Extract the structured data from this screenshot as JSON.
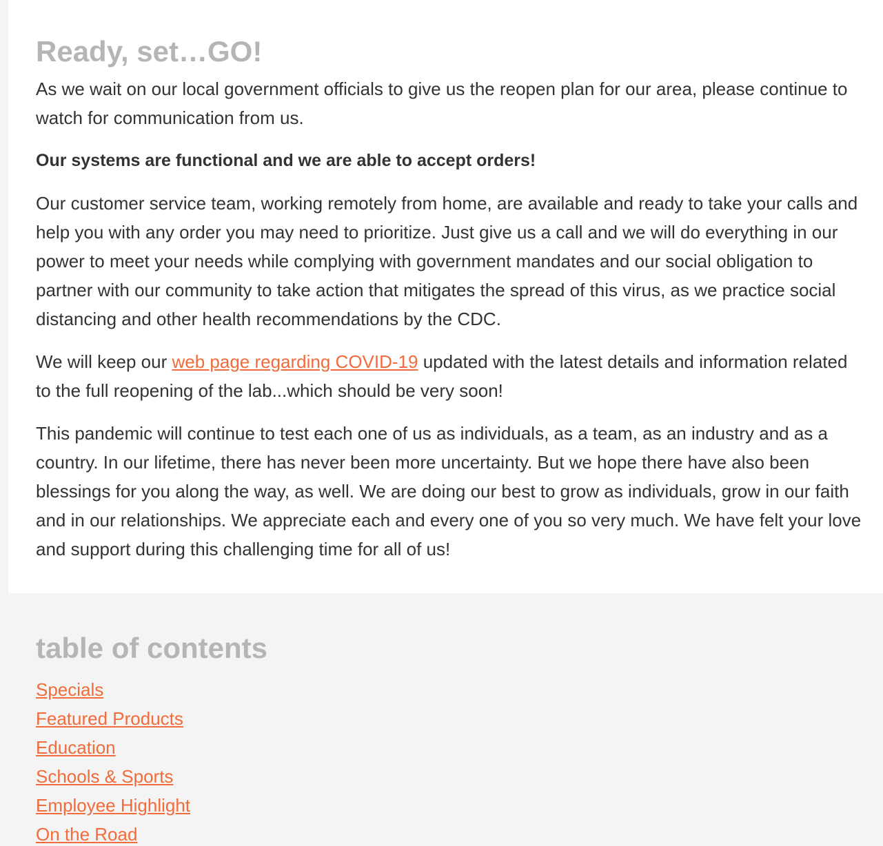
{
  "article": {
    "title": "Ready, set…GO!",
    "p1": "As we wait on our local government officials to give us the reopen plan for our area, please continue to watch for communication from us.",
    "p2": "Our systems are functional and we are able to accept orders!",
    "p3": "Our customer service team, working remotely from home, are available and ready to take your calls and help you with any order you may need to prioritize. Just give us a call and we will do everything in our power to meet your needs while complying with government mandates and our social obligation to partner with our community to take action that mitigates the spread of this virus, as we practice social distancing and other health recommendations by the CDC.",
    "p4_before": "We will keep our ",
    "p4_link": "web page regarding COVID-19",
    "p4_after": " updated with the latest details and information related to the full reopening of the lab...which should be very soon!",
    "p5": "This pandemic will continue to test each one of us as individuals, as a team, as an industry and as a country. In our lifetime, there has never been more uncertainty. But we hope there have also been blessings for you along the way, as well. We are doing our best to grow as individuals, grow in our faith and in our relationships. We appreciate each and every one of you so very much. We have felt your love and support during this challenging time for all of us!"
  },
  "toc": {
    "title": "table of contents",
    "items": [
      {
        "label": "Specials"
      },
      {
        "label": "Featured Products"
      },
      {
        "label": "Education"
      },
      {
        "label": "Schools & Sports"
      },
      {
        "label": "Employee Highlight"
      },
      {
        "label": "On the Road"
      }
    ]
  },
  "colors": {
    "link": "#f26b3a",
    "heading": "#b5b5b5",
    "body_text": "#333333",
    "page_bg": "#f4f4f4",
    "card_bg": "#ffffff"
  }
}
